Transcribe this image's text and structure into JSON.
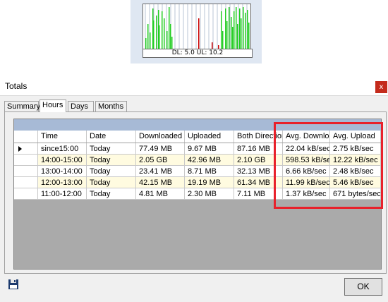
{
  "graph": {
    "label": "DL: 5.0 UL: 10.2",
    "download_color": "#22cc22",
    "upload_color": "#cc0000"
  },
  "dialog": {
    "title": "Totals",
    "close_label": "x",
    "tabs": [
      {
        "label": "Summary",
        "active": false
      },
      {
        "label": "Hours",
        "active": true
      },
      {
        "label": "Days",
        "active": false
      },
      {
        "label": "Months",
        "active": false
      }
    ],
    "columns": [
      "Time",
      "Date",
      "Downloaded",
      "Uploaded",
      "Both Directions",
      "Avg. Download",
      "Avg. Upload"
    ],
    "rows": [
      {
        "time": "since15:00",
        "date": "Today",
        "downloaded": "77.49 MB",
        "uploaded": "9.67 MB",
        "both": "87.16 MB",
        "avg_down": "22.04 kB/sec",
        "avg_up": "2.75 kB/sec",
        "selected": true
      },
      {
        "time": "14:00-15:00",
        "date": "Today",
        "downloaded": "2.05 GB",
        "uploaded": "42.96 MB",
        "both": "2.10 GB",
        "avg_down": "598.53 kB/se",
        "avg_up": "12.22 kB/sec"
      },
      {
        "time": "13:00-14:00",
        "date": "Today",
        "downloaded": "23.41 MB",
        "uploaded": "8.71 MB",
        "both": "32.13 MB",
        "avg_down": "6.66 kB/sec",
        "avg_up": "2.48 kB/sec"
      },
      {
        "time": "12:00-13:00",
        "date": "Today",
        "downloaded": "42.15 MB",
        "uploaded": "19.19 MB",
        "both": "61.34 MB",
        "avg_down": "11.99 kB/sec",
        "avg_up": "5.46 kB/sec"
      },
      {
        "time": "11:00-12:00",
        "date": "Today",
        "downloaded": "4.81 MB",
        "uploaded": "2.30 MB",
        "both": "7.11 MB",
        "avg_down": "1.37 kB/sec",
        "avg_up": "671 bytes/sec"
      }
    ],
    "highlight_color": "#e8212b",
    "save_icon": "floppy-disk-icon",
    "ok_label": "OK"
  }
}
